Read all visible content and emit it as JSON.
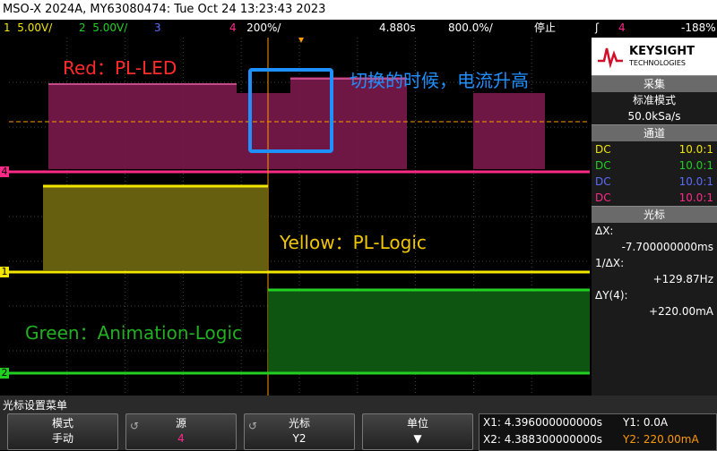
{
  "title": "MSO-X 2024A, MY63080474: Tue Oct 24 13:23:43 2023",
  "channels": [
    {
      "num": "1",
      "scale": "5.00V/",
      "color": "#f2e600"
    },
    {
      "num": "2",
      "scale": "5.00V/",
      "color": "#22d022"
    },
    {
      "num": "3",
      "scale": "",
      "color": "#5a6cff"
    },
    {
      "num": "4",
      "scale": "200%/",
      "color": "#ff2a88"
    }
  ],
  "timebase": {
    "delay": "4.880s",
    "scale": "800.0%/",
    "state": "停止",
    "trigger_level": "-188%"
  },
  "annotations": {
    "red_label": "Red：PL-LED",
    "yellow_label": "Yellow：PL-Logic",
    "green_label": "Green：Animation-Logic",
    "note": "切换的时候，电流升高"
  },
  "brand": {
    "name": "KEYSIGHT",
    "sub": "TECHNOLOGIES"
  },
  "acquisition": {
    "header": "采集",
    "mode": "标准模式",
    "rate": "50.0kSa/s"
  },
  "channels_panel": {
    "header": "通道",
    "rows": [
      {
        "coupling": "DC",
        "ratio": "10.0:1",
        "color": "#f2e600"
      },
      {
        "coupling": "DC",
        "ratio": "10.0:1",
        "color": "#22d022"
      },
      {
        "coupling": "DC",
        "ratio": "10.0:1",
        "color": "#5a6cff"
      },
      {
        "coupling": "DC",
        "ratio": "10.0:1",
        "color": "#ff2a88"
      }
    ]
  },
  "cursors_panel": {
    "header": "光标",
    "dx_label": "ΔX:",
    "dx_value": "-7.700000000ms",
    "inv_label": "1/ΔX:",
    "inv_value": "+129.87Hz",
    "dy_label": "ΔY(4):",
    "dy_value": "+220.00mA"
  },
  "menu": {
    "title": "光标设置菜单",
    "keys": [
      {
        "top": "模式",
        "bottom": "手动"
      },
      {
        "top": "源",
        "bottom": "4"
      },
      {
        "top": "光标",
        "bottom": "Y2"
      },
      {
        "top": "单位",
        "bottom": "▼"
      }
    ]
  },
  "readout": {
    "x1": "X1: 4.396000000000s",
    "x2": "X2: 4.388300000000s",
    "y1": "Y1: 0.0A",
    "y2": "Y2: 220.00mA"
  },
  "colors": {
    "ch1": "#f2e600",
    "ch2": "#22d022",
    "ch4": "#ff2a88",
    "highlight_box": "#1e90ff",
    "cursor": "#ff9a00"
  }
}
